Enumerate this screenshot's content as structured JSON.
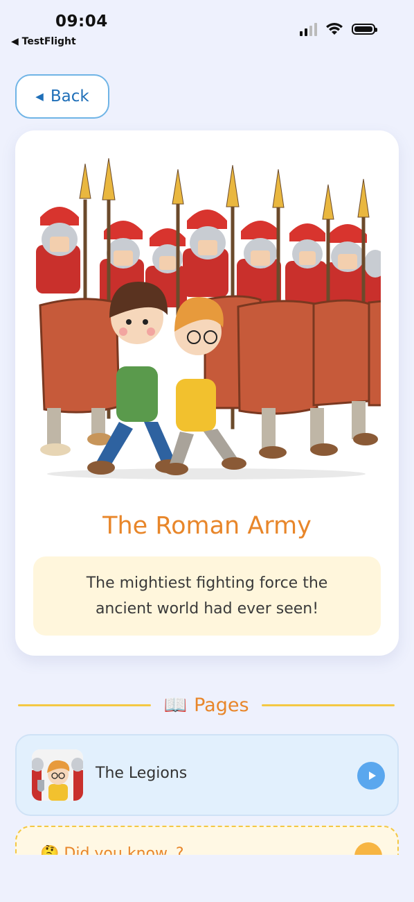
{
  "status_bar": {
    "time": "09:04",
    "back_app": "◀ TestFlight"
  },
  "nav": {
    "back_label": "Back",
    "back_icon": "◀"
  },
  "hero": {
    "title": "The Roman Army",
    "subtitle": "The mightiest fighting force the ancient world had ever seen!",
    "image_description_icon": "roman-soldiers-illustration"
  },
  "pages_section": {
    "icon": "📖",
    "label": "Pages"
  },
  "pages": [
    {
      "title": "The Legions"
    }
  ],
  "did_you_know": {
    "icon": "🤔",
    "label": "Did you know..?"
  },
  "colors": {
    "accent": "#e8862a",
    "blue": "#5aa7ee",
    "yellow": "#f4c843"
  }
}
